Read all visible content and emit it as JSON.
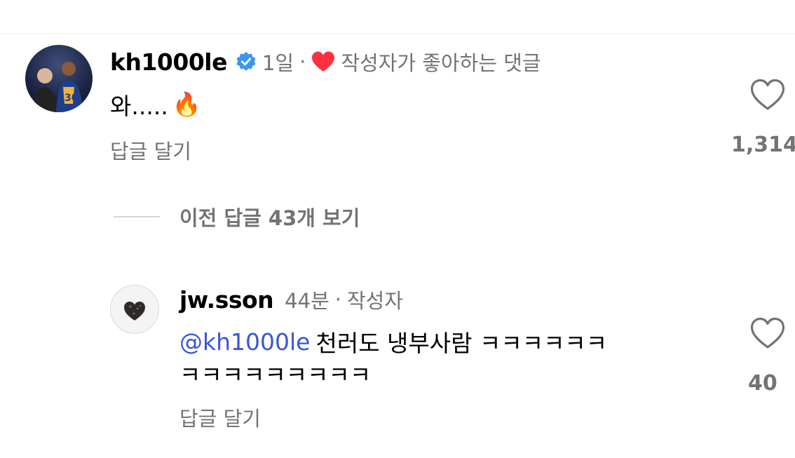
{
  "comments": [
    {
      "username": "kh1000le",
      "time": "1일",
      "separator": "·",
      "author_liked": "작성자가 좋아하는 댓글",
      "text": "와.....",
      "emoji": "🔥",
      "reply": "답글 달기",
      "likes": "1,314",
      "verified": true
    },
    {
      "username": "jw.sson",
      "time": "44분",
      "separator": "·",
      "author_badge": "작성자",
      "mention": "@kh1000le",
      "text_line1": "천러도 냉부사람 ㅋㅋㅋㅋㅋㅋ",
      "text_line2": "ㅋㅋㅋㅋㅋㅋㅋㅋㅋ",
      "reply": "답글 달기",
      "likes": "40"
    }
  ],
  "view_previous": "이전 답글 43개 보기",
  "colors": {
    "meta": "#737373",
    "mention": "#3a55d8",
    "verified": "#3797f0",
    "heart": "#ff3040"
  }
}
